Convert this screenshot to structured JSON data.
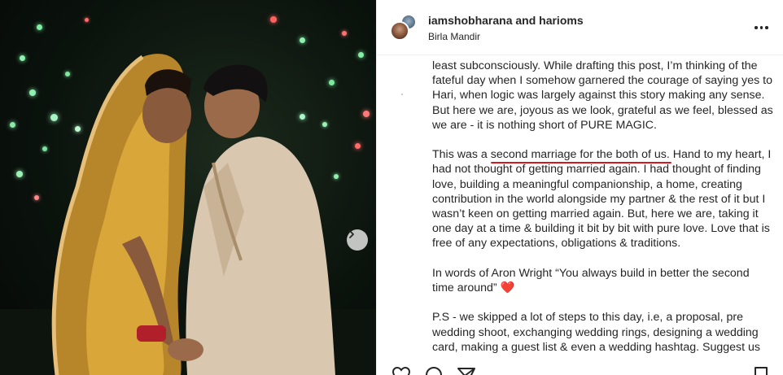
{
  "post": {
    "usernames": "iamshobharana and harioms",
    "location": "Birla Mandir",
    "caption": {
      "p1": "least subconsciously. While drafting this post, I’m thinking of the fateful day when I somehow garnered the courage of saying yes to Hari, when logic was largely against this story making any sense. But here we are, joyous as we look, grateful as we feel, blessed as we are - it is nothing short of PURE MAGIC.",
      "p2_before": "This was a ",
      "p2_highlight": "second marriage for the both of us.",
      "p2_after": " Hand to my heart, I had not thought of getting married again. I had thought of finding love, building a meaningful companionship, a home, creating contribution in the world alongside my partner & the rest of it but I wasn’t keen on getting married again. But, here we are, taking it one day at a time & building it bit by bit with pure love. Love that is free of any expectations, obligations & traditions.",
      "p3": "In words of Aron Wright “You always build in better the second time around”",
      "p3_emoji": "❤️",
      "p4": "P.S - we skipped a lot of steps to this day, i.e, a proposal, pre wedding shoot, exchanging wedding rings, designing a wedding card, making a guest list & even a wedding hashtag. Suggest us"
    }
  },
  "colors": {
    "text": "#262626",
    "underline": "#d4191c",
    "divider": "#efefef"
  },
  "icons": [
    "more-options-icon",
    "next-arrow-icon",
    "like-icon",
    "comment-icon",
    "share-icon",
    "save-icon"
  ]
}
